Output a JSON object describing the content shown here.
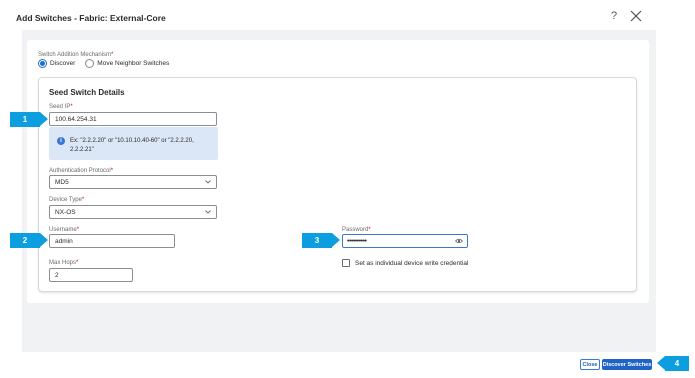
{
  "dialog": {
    "title": "Add Switches - Fabric: External-Core",
    "help_glyph": "?"
  },
  "mechanism": {
    "label": "Switch Addition Mechanism",
    "required_mark": "*",
    "options": [
      {
        "label": "Discover",
        "selected": true
      },
      {
        "label": "Move Neighbor Switches",
        "selected": false
      }
    ]
  },
  "seed": {
    "title": "Seed Switch Details",
    "seed_ip_label": "Seed IP",
    "seed_ip_value": "100.64.254.31",
    "info_icon": "i",
    "info_text": "Ex: \"2.2.2.20\" or \"10.10.10.40-60\" or \"2.2.2.20, 2.2.2.21\"",
    "auth_label": "Authentication Protocol",
    "auth_value": "MD5",
    "device_type_label": "Device Type",
    "device_type_value": "NX-OS",
    "username_label": "Username",
    "username_value": "admin",
    "max_hops_label": "Max Hops",
    "max_hops_value": "2",
    "password_label": "Password",
    "password_value": "••••••••••",
    "checkbox_label": "Set as individual device write credential",
    "checkbox_checked": false,
    "required_mark": "*"
  },
  "callouts": [
    "1",
    "2",
    "3",
    "4"
  ],
  "footer": {
    "close_label": "Close",
    "discover_label": "Discover Switches"
  },
  "colors": {
    "primary": "#1f63c6",
    "callout": "#0d9ee0",
    "info_bg": "#dbe6f6",
    "panel_bg": "#f1f2f4",
    "required": "#d0021b"
  },
  "icons": [
    "help-icon",
    "close-icon",
    "info-icon",
    "chevron-down-icon",
    "eye-icon"
  ]
}
